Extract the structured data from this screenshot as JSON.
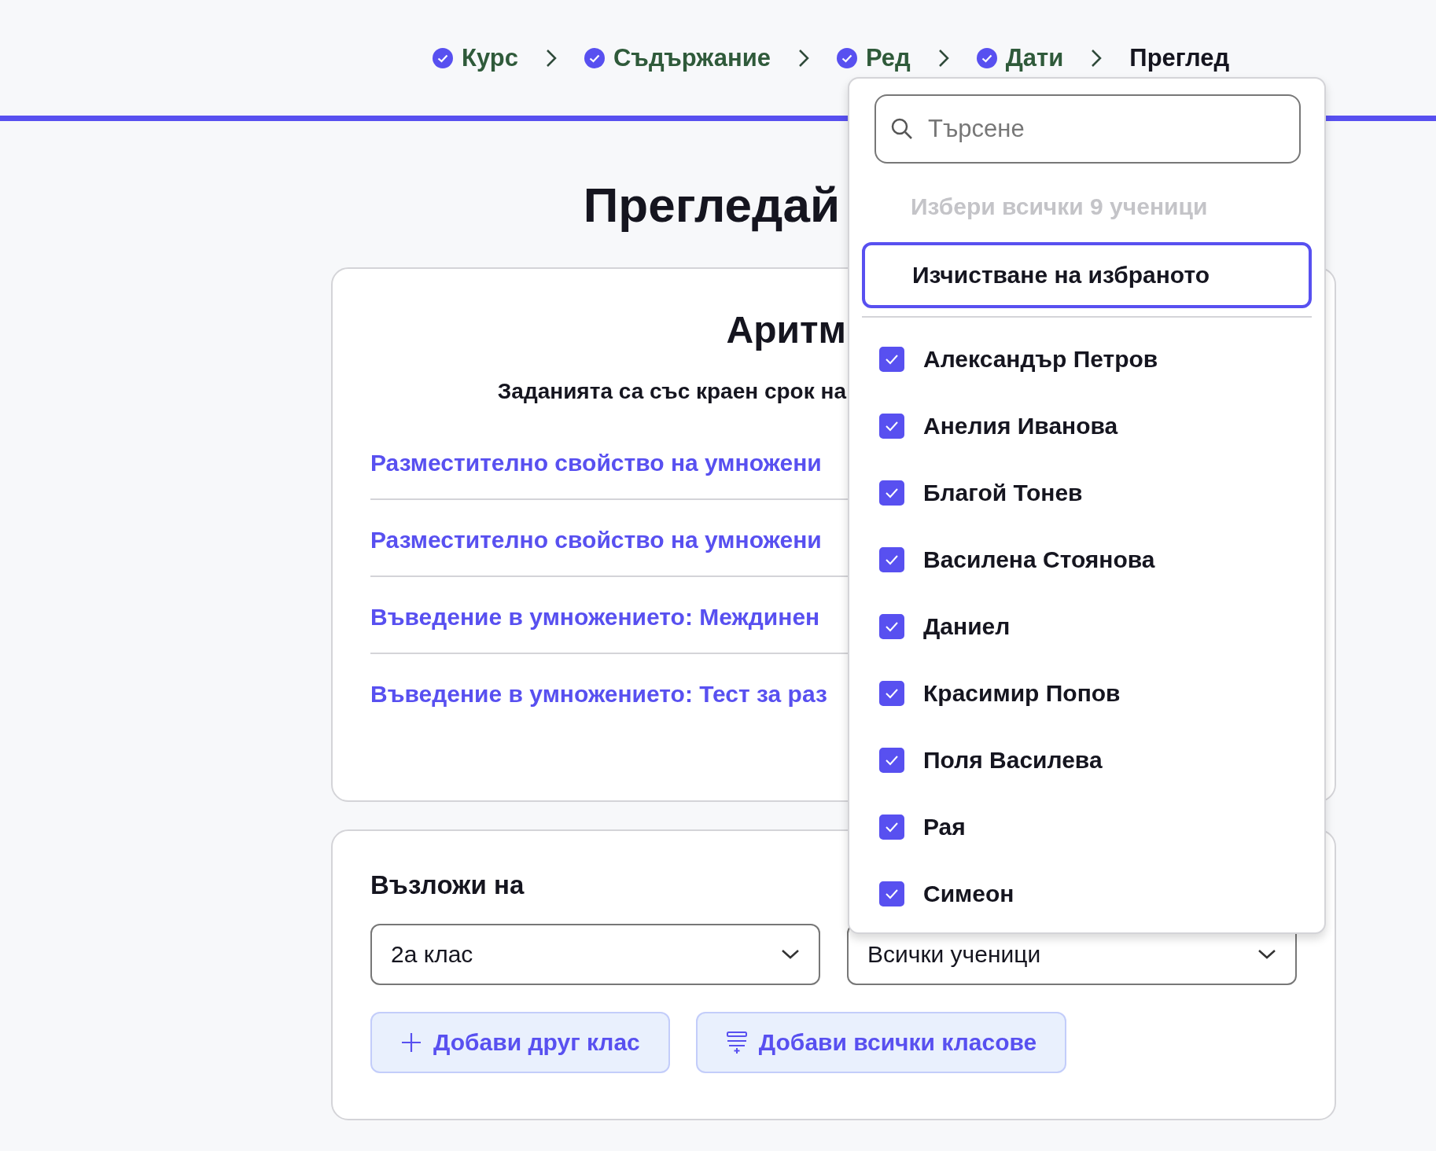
{
  "steps": [
    {
      "label": "Курс",
      "done": true
    },
    {
      "label": "Съдържание",
      "done": true
    },
    {
      "label": "Ред",
      "done": true
    },
    {
      "label": "Дати",
      "done": true
    },
    {
      "label": "Преглед",
      "done": false
    }
  ],
  "progress": {
    "level": 1
  },
  "heading": "Прегледай",
  "assignment": {
    "title": "Аритм",
    "subtitle": "Заданията са със краен срок на",
    "links": [
      "Разместително свойство на умножени",
      "Разместително свойство на умножени",
      "Въведение в умножението: Междинен",
      "Въведение в умножението: Тест за раз"
    ]
  },
  "assign": {
    "label": "Възложи на",
    "class_select": {
      "value": "2а клас"
    },
    "students_select": {
      "value": "Всички ученици"
    },
    "buttons": [
      {
        "kind": "plus",
        "label": "Добави друг клас"
      },
      {
        "kind": "list",
        "label": "Добави всички класове"
      }
    ]
  },
  "dropdown": {
    "search": {
      "placeholder": "Търсене"
    },
    "select_all": {
      "label": "Избери всички 9 ученици",
      "disabled": true
    },
    "clear": {
      "label": "Изчистване на избраното"
    },
    "students": [
      {
        "name": "Александър Петров",
        "checked": true
      },
      {
        "name": "Анелия Иванова",
        "checked": true
      },
      {
        "name": "Благой Тонев",
        "checked": true
      },
      {
        "name": "Василена Стоянова",
        "checked": true
      },
      {
        "name": "Даниел",
        "checked": true
      },
      {
        "name": "Красимир Попов",
        "checked": true
      },
      {
        "name": "Поля Василева",
        "checked": true
      },
      {
        "name": "Рая",
        "checked": true
      },
      {
        "name": "Симеон",
        "checked": true
      }
    ]
  }
}
